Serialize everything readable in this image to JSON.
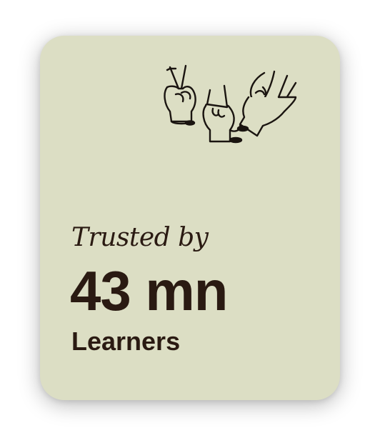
{
  "card": {
    "illustration_icon": "sign-language-hands-icon",
    "tagline": "Trusted by",
    "count": "43 mn",
    "unit": "Learners"
  },
  "colors": {
    "card_bg": "#dcdec4",
    "text": "#2a1a12"
  }
}
